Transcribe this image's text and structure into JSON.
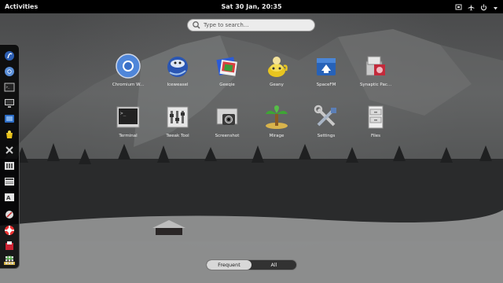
{
  "topbar": {
    "activities_label": "Activities",
    "clock": "Sat 30 Jan, 20:35",
    "tray_icons": [
      "notification-icon",
      "airplane-icon",
      "power-icon",
      "chevron-down-icon"
    ]
  },
  "search": {
    "placeholder": "Type to search..."
  },
  "dash": {
    "items": [
      "gnome-logo-icon",
      "chromium-icon",
      "terminal-icon",
      "display-icon",
      "spacefm-icon",
      "geany-icon",
      "settings-icon",
      "tweak-tool-icon",
      "document-icon",
      "font-icon",
      "gnome-software-icon",
      "help-icon",
      "synaptic-icon",
      "mirage-icon",
      "show-apps-icon"
    ]
  },
  "apps": [
    {
      "label": "Chromium W...",
      "icon": "chromium-icon"
    },
    {
      "label": "Iceweasel",
      "icon": "iceweasel-icon"
    },
    {
      "label": "Geeqie",
      "icon": "geeqie-icon"
    },
    {
      "label": "Geany",
      "icon": "geany-icon"
    },
    {
      "label": "SpaceFM",
      "icon": "spacefm-icon"
    },
    {
      "label": "Synaptic Pac...",
      "icon": "synaptic-icon"
    },
    {
      "label": "Terminal",
      "icon": "terminal-icon"
    },
    {
      "label": "Tweak Tool",
      "icon": "tweak-tool-icon"
    },
    {
      "label": "Screenshot",
      "icon": "screenshot-icon"
    },
    {
      "label": "Mirage",
      "icon": "mirage-icon"
    },
    {
      "label": "Settings",
      "icon": "settings-icon"
    },
    {
      "label": "Files",
      "icon": "files-icon"
    }
  ],
  "switcher": {
    "frequent_label": "Frequent",
    "all_label": "All",
    "selected": "Frequent"
  }
}
